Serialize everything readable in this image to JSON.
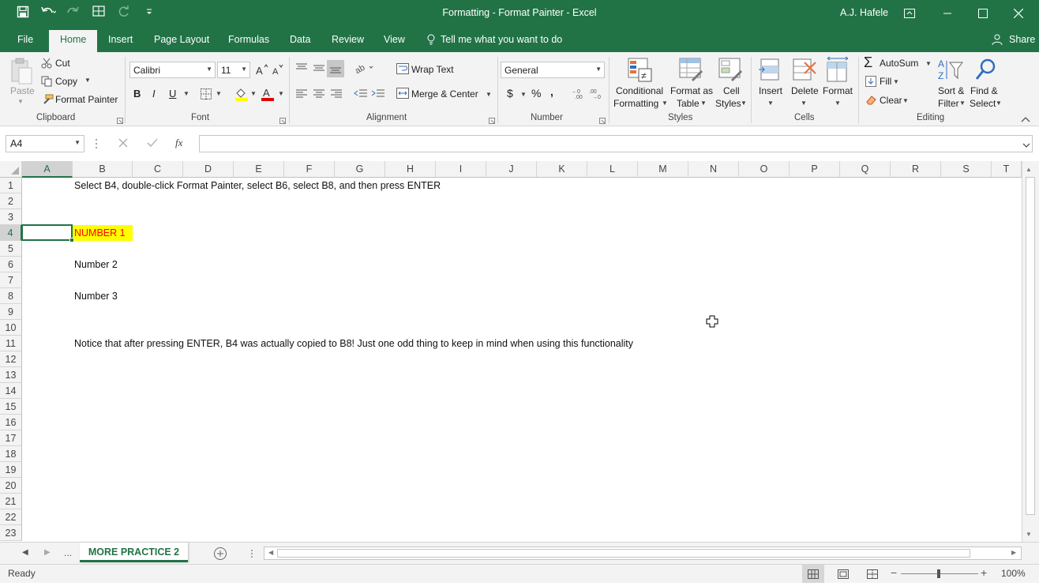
{
  "window": {
    "title": "Formatting - Format Painter - Excel",
    "user": "A.J. Hafele"
  },
  "tabs": {
    "file": "File",
    "home": "Home",
    "insert": "Insert",
    "page_layout": "Page Layout",
    "formulas": "Formulas",
    "data": "Data",
    "review": "Review",
    "view": "View",
    "tell_me": "Tell me what you want to do",
    "share": "Share"
  },
  "ribbon": {
    "clipboard": {
      "label": "Clipboard",
      "paste": "Paste",
      "cut": "Cut",
      "copy": "Copy",
      "format_painter": "Format Painter"
    },
    "font": {
      "label": "Font",
      "name": "Calibri",
      "size": "11",
      "bold": "B",
      "italic": "I",
      "underline": "U"
    },
    "alignment": {
      "label": "Alignment",
      "wrap_text": "Wrap Text",
      "merge_center": "Merge & Center"
    },
    "number": {
      "label": "Number",
      "format": "General",
      "currency": "$",
      "percent": "%",
      "comma": ","
    },
    "styles": {
      "label": "Styles",
      "conditional_line1": "Conditional",
      "conditional_line2": "Formatting",
      "format_table_line1": "Format as",
      "format_table_line2": "Table",
      "cell_styles_line1": "Cell",
      "cell_styles_line2": "Styles"
    },
    "cells": {
      "label": "Cells",
      "insert": "Insert",
      "delete": "Delete",
      "format": "Format"
    },
    "editing": {
      "label": "Editing",
      "autosum": "AutoSum",
      "fill": "Fill",
      "clear": "Clear",
      "sort_line1": "Sort &",
      "sort_line2": "Filter",
      "find_line1": "Find &",
      "find_line2": "Select"
    }
  },
  "formula_bar": {
    "name_box": "A4",
    "fx": "fx",
    "value": ""
  },
  "grid": {
    "columns": [
      "A",
      "B",
      "C",
      "D",
      "E",
      "F",
      "G",
      "H",
      "I",
      "J",
      "K",
      "L",
      "M",
      "N",
      "O",
      "P",
      "Q",
      "R",
      "S",
      "T"
    ],
    "rows": [
      "1",
      "2",
      "3",
      "4",
      "5",
      "6",
      "7",
      "8",
      "9",
      "10",
      "11",
      "12",
      "13",
      "14",
      "15",
      "16",
      "17",
      "18",
      "19",
      "20",
      "21",
      "22",
      "23"
    ],
    "cells": {
      "B1": "Select B4, double-click Format Painter, select B6, select B8, and then press ENTER",
      "B4": "NUMBER 1",
      "B6": "Number 2",
      "B8": "Number 3",
      "B11": "Notice that after pressing ENTER, B4 was actually copied to B8!  Just one odd thing to keep in mind when using this functionality"
    },
    "selected_cell": "A4",
    "highlight_color": "#ffff00",
    "highlight_text_color": "#ff0000"
  },
  "sheets": {
    "ellipsis": "...",
    "active": "MORE PRACTICE 2"
  },
  "status": {
    "ready": "Ready",
    "zoom": "100%"
  },
  "colors": {
    "accent": "#217346"
  }
}
